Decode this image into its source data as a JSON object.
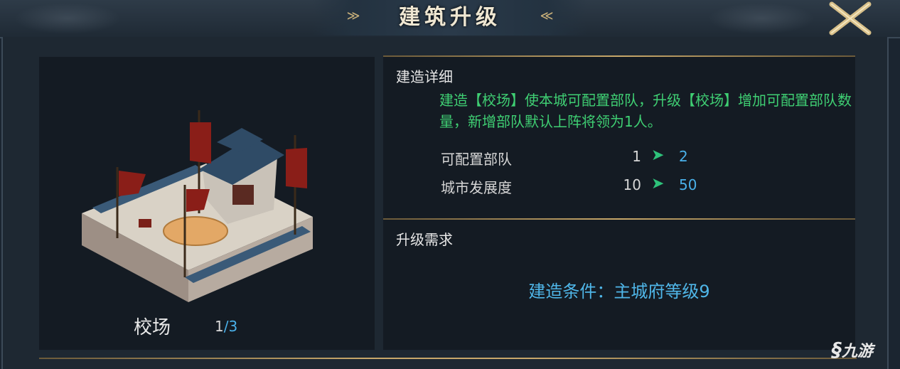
{
  "header": {
    "title": "建筑升级",
    "title_ornament_left": "≫",
    "title_ornament_right": "≪"
  },
  "building": {
    "name": "校场",
    "level_current": "1",
    "level_sep": "/",
    "level_max": "3",
    "illustration": "training-ground-illustration"
  },
  "details": {
    "section_title": "建造详细",
    "description": "建造【校场】使本城可配置部队，升级【校场】增加可配置部队数量，新增部队默认上阵将领为1人。",
    "stats": [
      {
        "label": "可配置部队",
        "from": "1",
        "arrow": "➤",
        "to": "2"
      },
      {
        "label": "城市发展度",
        "from": "10",
        "arrow": "➤",
        "to": "50"
      }
    ]
  },
  "requirements": {
    "section_title": "升级需求",
    "condition": "建造条件：主城府等级9"
  },
  "watermark": {
    "text": "九游"
  },
  "colors": {
    "accent_gold": "#c8a86a",
    "description_green": "#3fcf73",
    "value_blue": "#4ab1ea",
    "arrow_green": "#2ec27a"
  },
  "icons": {
    "close": "close-x-icon"
  }
}
